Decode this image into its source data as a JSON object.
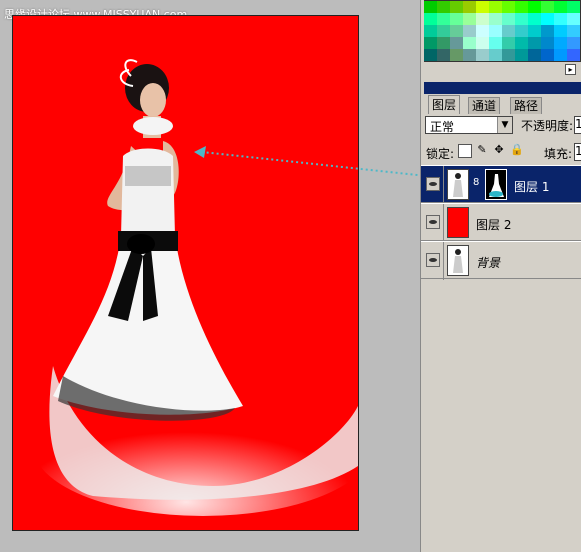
{
  "watermark": "思缘设计论坛  www.MISSYUAN.com",
  "swatch_colors": [
    [
      "#00cc00",
      "#33cc00",
      "#66cc00",
      "#99cc00",
      "#ccff00",
      "#99ff00",
      "#66ff00",
      "#33ff00",
      "#00ff00",
      "#33ff33",
      "#00ff33",
      "#00ff66"
    ],
    [
      "#00ff99",
      "#33ff99",
      "#66ff99",
      "#99ff99",
      "#ccffcc",
      "#99ffcc",
      "#66ffcc",
      "#33ffcc",
      "#00ffcc",
      "#00ffff",
      "#33ffff",
      "#66ffff"
    ],
    [
      "#00cc99",
      "#33cc99",
      "#66cc99",
      "#99cccc",
      "#ccffff",
      "#99ffff",
      "#66cccc",
      "#33cccc",
      "#00cccc",
      "#0099cc",
      "#00ccff",
      "#33ccff"
    ],
    [
      "#009966",
      "#339966",
      "#669999",
      "#99ffcc",
      "#ccffee",
      "#66ffee",
      "#33ccaa",
      "#00bbaa",
      "#0099aa",
      "#0088cc",
      "#00aaff",
      "#3399ff"
    ],
    [
      "#006666",
      "#336666",
      "#669966",
      "#669999",
      "#99cccc",
      "#66cccc",
      "#339999",
      "#009999",
      "#006699",
      "#0066cc",
      "#0099ff",
      "#3366ff"
    ]
  ],
  "panel": {
    "tabs": {
      "layers": "图层",
      "channels": "通道",
      "paths": "路径"
    },
    "blend_mode": "正常",
    "opacity_label": "不透明度:",
    "opacity_value": "1",
    "lock_label": "锁定:",
    "fill_label": "填充:",
    "fill_value": "1"
  },
  "layers": [
    {
      "name": "图层 1",
      "selected": true,
      "has_mask": true
    },
    {
      "name": "图层 2",
      "selected": false,
      "color": "#ff0000"
    },
    {
      "name": "背景",
      "selected": false,
      "italic": true
    }
  ],
  "colors": {
    "canvas_red": "#ff0000",
    "selection_blue": "#0a246a",
    "arrow": "#4db8c8"
  }
}
